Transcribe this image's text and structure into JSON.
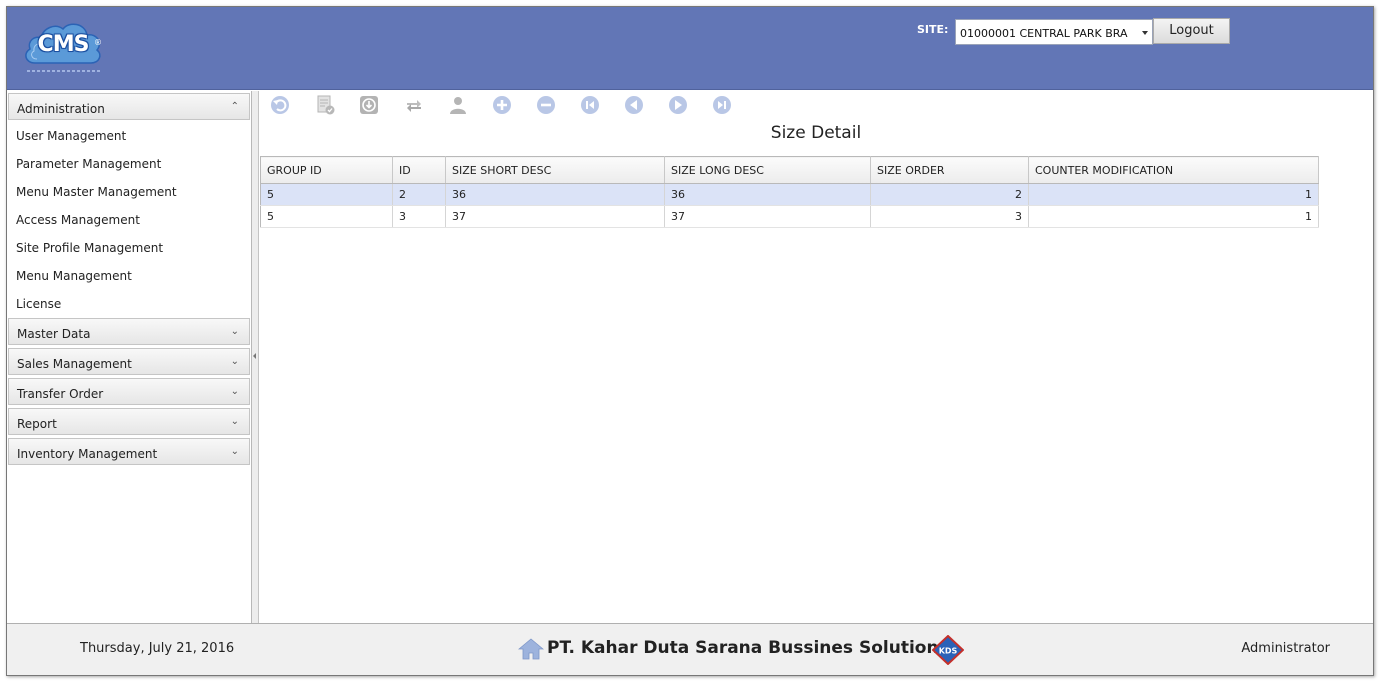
{
  "header": {
    "logo_text": "CMS",
    "site_label": "SITE:",
    "site_value": "01000001 CENTRAL PARK BRA",
    "logout_label": "Logout"
  },
  "sidebar": {
    "sections": [
      {
        "label": "Administration",
        "expanded": true
      },
      {
        "label": "Master Data",
        "expanded": false
      },
      {
        "label": "Sales Management",
        "expanded": false
      },
      {
        "label": "Transfer Order",
        "expanded": false
      },
      {
        "label": "Report",
        "expanded": false
      },
      {
        "label": "Inventory Management",
        "expanded": false
      }
    ],
    "admin_items": [
      "User Management",
      "Parameter Management",
      "Menu Master Management",
      "Access Management",
      "Site Profile Management",
      "Menu Management",
      "License"
    ]
  },
  "toolbar": {
    "icons": [
      "undo-icon",
      "approve-document-icon",
      "download-icon",
      "refresh-icon",
      "user-icon",
      "add-icon",
      "remove-icon",
      "first-record-icon",
      "previous-record-icon",
      "next-record-icon",
      "last-record-icon"
    ]
  },
  "main": {
    "title": "Size Detail",
    "columns": [
      "GROUP ID",
      "ID",
      "SIZE SHORT DESC",
      "SIZE LONG DESC",
      "SIZE ORDER",
      "COUNTER MODIFICATION"
    ],
    "rows": [
      [
        "5",
        "2",
        "36",
        "36",
        "2",
        "1"
      ],
      [
        "5",
        "3",
        "37",
        "37",
        "3",
        "1"
      ]
    ]
  },
  "footer": {
    "date": "Thursday, July 21, 2016",
    "company": "PT. Kahar Duta Sarana Bussines Solutions",
    "kds_logo_text": "KDS",
    "user": "Administrator"
  },
  "colors": {
    "header_bg": "#6276b6",
    "toolbar_icon": "#b9c7e6",
    "selected_row": "#dbe3f7"
  }
}
